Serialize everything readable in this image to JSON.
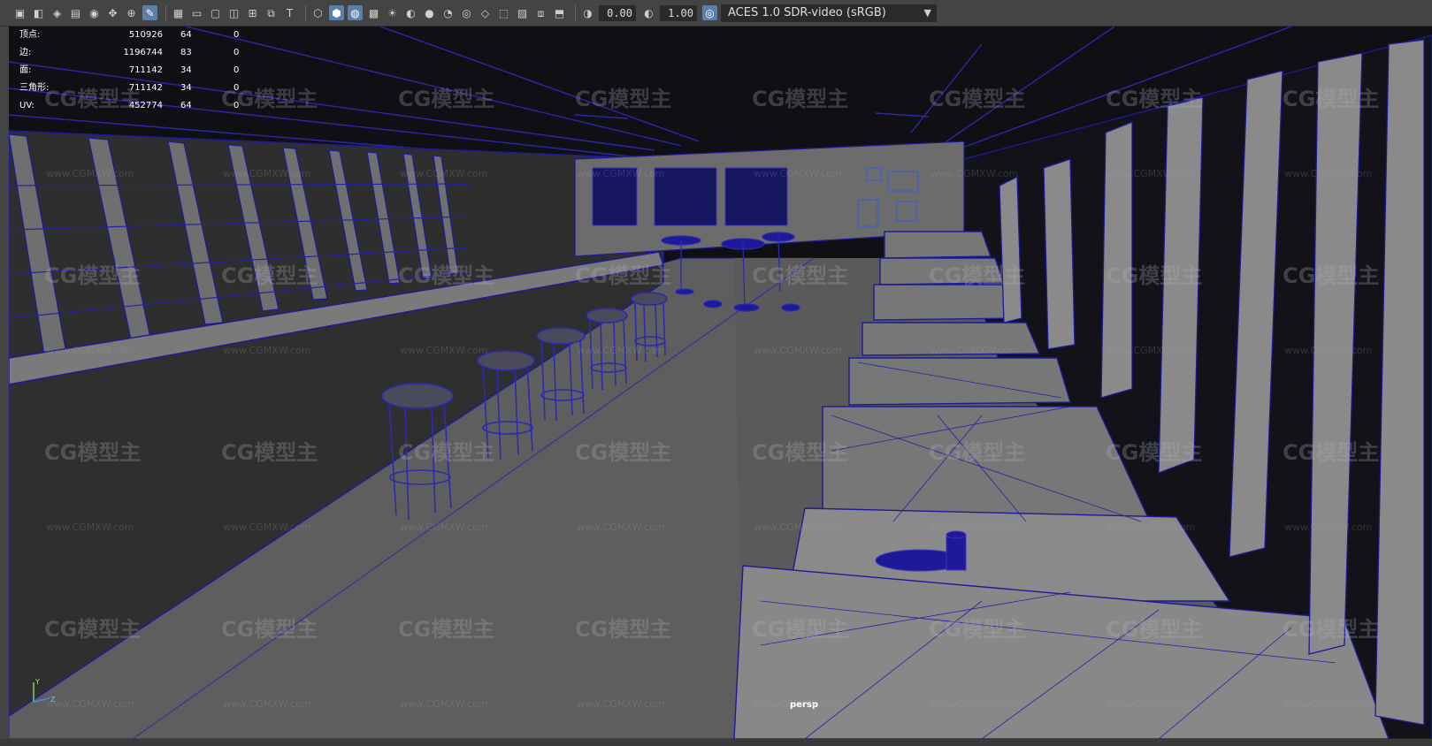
{
  "toolbar": {
    "icons": [
      "camera-icon",
      "camera-attr-icon",
      "bookmark-icon",
      "image-plane-icon",
      "snapshot-icon",
      "move-tool-icon",
      "transform-icon",
      "grease-pencil-icon"
    ],
    "display_icons": [
      "grid-icon",
      "film-gate-icon",
      "resolution-gate-icon",
      "gate-mask-icon",
      "field-chart-icon",
      "safe-action-icon",
      "safe-title-icon"
    ],
    "shading_icons": [
      "wireframe-icon",
      "smooth-shade-icon",
      "wireframe-on-shaded-icon",
      "textured-icon",
      "use-lights-icon",
      "shadows-icon",
      "ambient-occlusion-icon",
      "motion-blur-icon",
      "anti-alias-icon",
      "depth-of-field-icon",
      "isolate-select-icon",
      "xray-icon",
      "xray-joints-icon",
      "xray-components-icon"
    ],
    "exposure_icon": "exposure-icon",
    "exposure_value": "0.00",
    "gamma_icon": "gamma-icon",
    "gamma_value": "1.00",
    "color_mgmt_icon": "color-management-icon",
    "color_space": "ACES 1.0 SDR-video (sRGB)"
  },
  "hud": {
    "rows": [
      {
        "label": "顶点:",
        "v1": "510926",
        "v2": "64",
        "v3": "0"
      },
      {
        "label": "边:",
        "v1": "1196744",
        "v2": "83",
        "v3": "0"
      },
      {
        "label": "面:",
        "v1": "711142",
        "v2": "34",
        "v3": "0"
      },
      {
        "label": "三角形:",
        "v1": "711142",
        "v2": "34",
        "v3": "0"
      },
      {
        "label": "UV:",
        "v1": "452774",
        "v2": "64",
        "v3": "0"
      }
    ]
  },
  "viewport": {
    "camera_label": "persp",
    "axis_y": "Y",
    "axis_z": "Z",
    "wireframe_color": "#1d1a9a",
    "background_color": "#333333",
    "floor_color": "#5e5e5e"
  },
  "watermark": {
    "logo": "CG模型主",
    "url": "www.CGMXW.com"
  }
}
